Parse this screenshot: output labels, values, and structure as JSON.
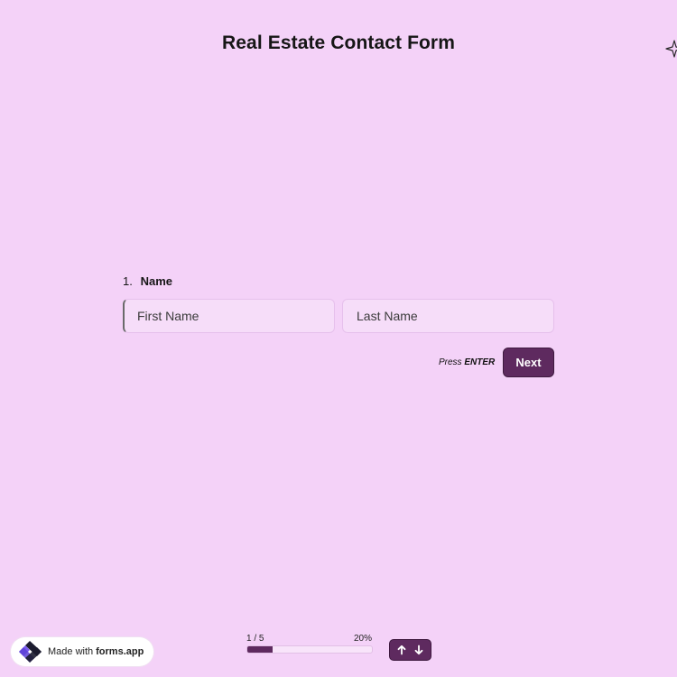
{
  "form": {
    "title": "Real Estate Contact Form"
  },
  "question": {
    "number": "1.",
    "label": "Name",
    "first_name_placeholder": "First Name",
    "last_name_placeholder": "Last Name"
  },
  "actions": {
    "hint_press": "Press",
    "hint_key": "ENTER",
    "next_label": "Next"
  },
  "progress": {
    "count_text": "1 / 5",
    "percent_text": "20%",
    "fraction": 0.2
  },
  "badge": {
    "made_with": "Made with",
    "brand": "forms.app"
  },
  "icons": {
    "sparkle": "sparkle-icon",
    "logo": "forms-app-logo",
    "up": "arrow-up-icon",
    "down": "arrow-down-icon"
  },
  "colors": {
    "background": "#f4d2f8",
    "accent": "#5e2a5f"
  }
}
